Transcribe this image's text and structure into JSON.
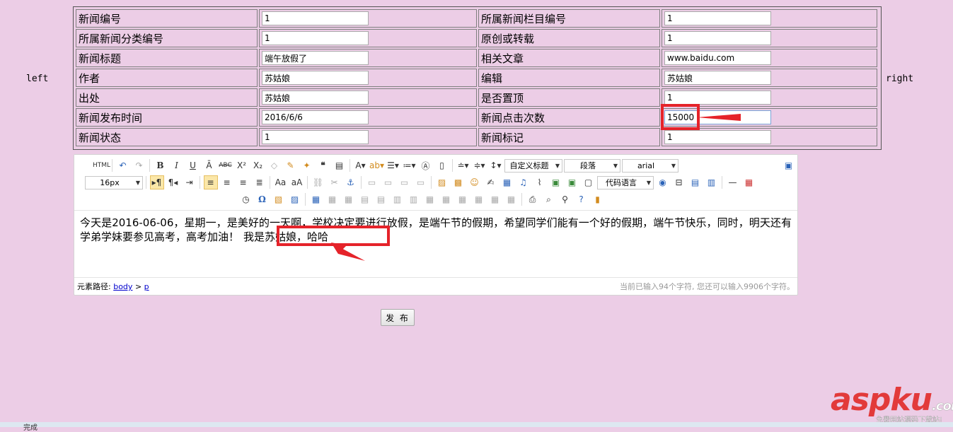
{
  "side": {
    "left": "left",
    "right": "right"
  },
  "form": {
    "rows": [
      {
        "label1": "新闻编号",
        "value1": "1",
        "label2": "所属新闻栏目编号",
        "value2": "1"
      },
      {
        "label1": "所属新闻分类编号",
        "value1": "1",
        "label2": "原创或转载",
        "value2": "1"
      },
      {
        "label1": "新闻标题",
        "value1": "端午放假了",
        "label2": "相关文章",
        "value2": "www.baidu.com"
      },
      {
        "label1": "作者",
        "value1": "苏姑娘",
        "label2": "编辑",
        "value2": "苏姑娘"
      },
      {
        "label1": "出处",
        "value1": "苏姑娘",
        "label2": "是否置顶",
        "value2": "1"
      },
      {
        "label1": "新闻发布时间",
        "value1": "2016/6/6",
        "label2": "新闻点击次数",
        "value2": "15000"
      },
      {
        "label1": "新闻状态",
        "value1": "1",
        "label2": "新闻标记",
        "value2": "1"
      }
    ]
  },
  "editor": {
    "toolbar": {
      "html_label": "HTML",
      "custom_heading": "自定义标题",
      "paragraph": "段落",
      "font_family": "arial",
      "font_size": "16px",
      "code_language": "代码语言"
    },
    "content": {
      "text": "今天是2016-06-06，星期一，是美好的一天啊，学校决定要进行放假，是端午节的假期，希望同学们能有一个好的假期，端午节快乐，同时，明天还有学弟学妹要参见高考，高考加油！",
      "highlight": "我是苏姑娘，哈哈"
    },
    "status": {
      "path_label": "元素路径:",
      "path_body": "body",
      "path_sep": ">",
      "path_p": "p",
      "char_count": "当前已输入94个字符, 您还可以输入9906个字符。"
    }
  },
  "publish_label": "发 布",
  "watermark": {
    "brand": "aspku",
    "domain": ".com",
    "tagline": "免费网站源码下载站!"
  },
  "status_text": "完成",
  "colors": {
    "page_bg": "#eccde6",
    "annotation_red": "#e5232a",
    "link": "#0000cc"
  }
}
